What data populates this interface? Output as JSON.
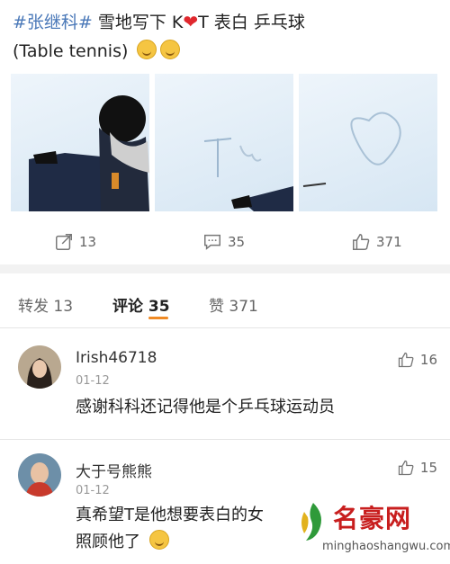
{
  "post": {
    "hashtag": "#张继科#",
    "text_before_heart": " 雪地写下 K",
    "heart": "❤",
    "text_after_heart": "T 表白 乒乓球",
    "line2": "(Table tennis)"
  },
  "actions": {
    "repost": "13",
    "comment": "35",
    "like": "371"
  },
  "tabs": [
    {
      "label": "转发 13"
    },
    {
      "label": "评论 35"
    },
    {
      "label": "赞 371"
    }
  ],
  "comments": [
    {
      "user": "Irish46718",
      "date": "01-12",
      "text": "感谢科科还记得他是个乒乓球运动员",
      "likes": "16"
    },
    {
      "user": "大于号熊熊",
      "date": "01-12",
      "text_line1": "真希望T是他想要表白的女",
      "text_line2": "照顾他了",
      "likes": "15"
    }
  ],
  "watermark": {
    "title": "名豪网",
    "url": "minghaoshangwu.com"
  },
  "colors": {
    "hashtag": "#4a78b8",
    "accent": "#f08a24",
    "brand_red": "#c81e1e"
  }
}
